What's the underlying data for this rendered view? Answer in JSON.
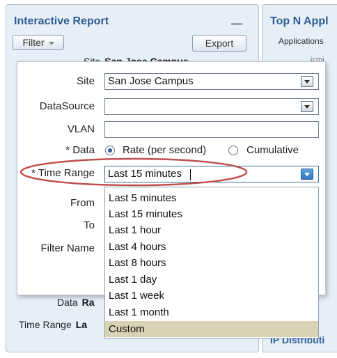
{
  "left_panel": {
    "title": "Interactive Report",
    "filter_label": "Filter",
    "export_label": "Export",
    "bg_site_label": "Site",
    "bg_site_value": "San Jose Campus",
    "bg_data_label": "Data",
    "bg_data_value": "Ra",
    "bg_time_label": "Time Range",
    "bg_time_value": "La"
  },
  "right_panel": {
    "title": "Top N Appl",
    "subtitle": "Applications",
    "faint_text": "icmi",
    "bottom_title": "IP Distributi"
  },
  "filter_form": {
    "site_label": "Site",
    "site_value": "San Jose Campus",
    "datasource_label": "DataSource",
    "datasource_value": "",
    "vlan_label": "VLAN",
    "vlan_value": "",
    "data_label": "* Data",
    "data_options": [
      "Rate (per second)",
      "Cumulative"
    ],
    "data_selected": "Rate (per second)",
    "time_range_label": "* Time Range",
    "time_range_value": "Last 15 minutes",
    "from_label": "From",
    "to_label": "To",
    "filter_name_label": "Filter Name"
  },
  "time_range_options": [
    "Last 5 minutes",
    "Last 15 minutes",
    "Last 1 hour",
    "Last 4 hours",
    "Last 8 hours",
    "Last 1 day",
    "Last 1 week",
    "Last 1 month",
    "Custom"
  ],
  "time_range_highlighted": "Custom",
  "colors": {
    "panel_title": "#2f5e96",
    "panel_bg": "#e6eef6",
    "highlight_ellipse": "#c0504d",
    "selected_option_bg": "#d8d3b4",
    "active_dropdown_button": "#2f78c0"
  }
}
